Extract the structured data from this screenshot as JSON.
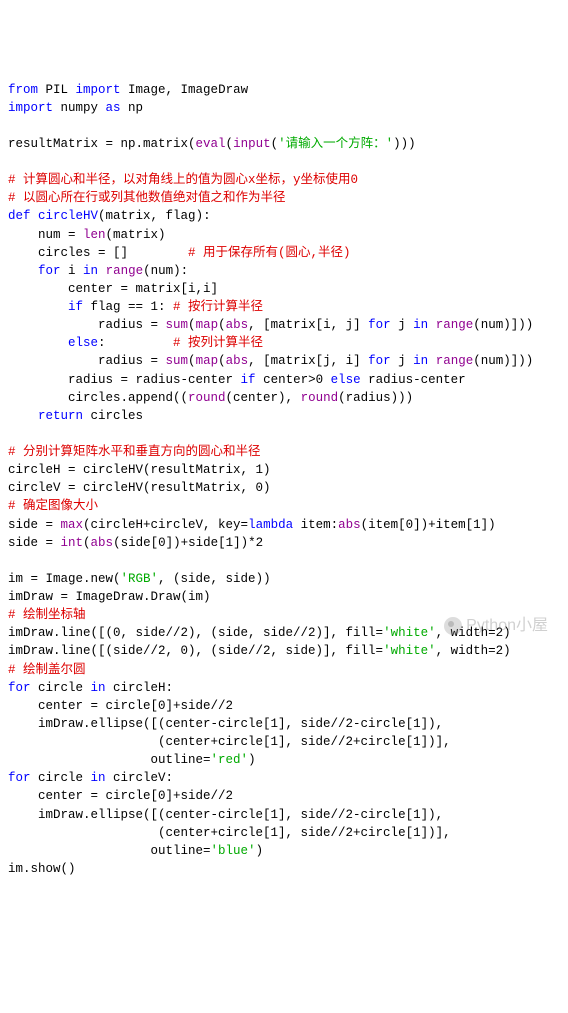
{
  "code": {
    "l01a": "from",
    "l01b": " PIL ",
    "l01c": "import",
    "l01d": " Image, ImageDraw",
    "l02a": "import",
    "l02b": " numpy ",
    "l02c": "as",
    "l02d": " np",
    "l03": "",
    "l04a": "resultMatrix = np.matrix(",
    "l04b": "eval",
    "l04c": "(",
    "l04d": "input",
    "l04e": "(",
    "l04f": "'请输入一个方阵：'",
    "l04g": ")))",
    "l05": "",
    "l06": "# 计算圆心和半径，以对角线上的值为圆心x坐标，y坐标使用0",
    "l07": "# 以圆心所在行或列其他数值绝对值之和作为半径",
    "l08a": "def",
    "l08b": " ",
    "l08c": "circleHV",
    "l08d": "(matrix, flag):",
    "l09a": "    num = ",
    "l09b": "len",
    "l09c": "(matrix)",
    "l10a": "    circles = []        ",
    "l10b": "# 用于保存所有(圆心,半径)",
    "l11a": "    ",
    "l11b": "for",
    "l11c": " i ",
    "l11d": "in",
    "l11e": " ",
    "l11f": "range",
    "l11g": "(num):",
    "l12": "        center = matrix[i,i]",
    "l13a": "        ",
    "l13b": "if",
    "l13c": " flag == 1: ",
    "l13d": "# 按行计算半径",
    "l14a": "            radius = ",
    "l14b": "sum",
    "l14c": "(",
    "l14d": "map",
    "l14e": "(",
    "l14f": "abs",
    "l14g": ", [matrix[i, j] ",
    "l14h": "for",
    "l14i": " j ",
    "l14j": "in",
    "l14k": " ",
    "l14l": "range",
    "l14m": "(num)]))",
    "l15a": "        ",
    "l15b": "else",
    "l15c": ":         ",
    "l15d": "# 按列计算半径",
    "l16a": "            radius = ",
    "l16b": "sum",
    "l16c": "(",
    "l16d": "map",
    "l16e": "(",
    "l16f": "abs",
    "l16g": ", [matrix[j, i] ",
    "l16h": "for",
    "l16i": " j ",
    "l16j": "in",
    "l16k": " ",
    "l16l": "range",
    "l16m": "(num)]))",
    "l17a": "        radius = radius-center ",
    "l17b": "if",
    "l17c": " center>0 ",
    "l17d": "else",
    "l17e": " radius-center",
    "l18a": "        circles.append((",
    "l18b": "round",
    "l18c": "(center), ",
    "l18d": "round",
    "l18e": "(radius)))",
    "l19a": "    ",
    "l19b": "return",
    "l19c": " circles",
    "l20": "",
    "l21": "# 分别计算矩阵水平和垂直方向的圆心和半径",
    "l22": "circleH = circleHV(resultMatrix, 1)",
    "l23": "circleV = circleHV(resultMatrix, 0)",
    "l24": "# 确定图像大小",
    "l25a": "side = ",
    "l25b": "max",
    "l25c": "(circleH+circleV, key=",
    "l25d": "lambda",
    "l25e": " item:",
    "l25f": "abs",
    "l25g": "(item[0])+item[1])",
    "l26a": "side = ",
    "l26b": "int",
    "l26c": "(",
    "l26d": "abs",
    "l26e": "(side[0])+side[1])*2",
    "l27": "",
    "l28a": "im = Image.new(",
    "l28b": "'RGB'",
    "l28c": ", (side, side))",
    "l29": "imDraw = ImageDraw.Draw(im)",
    "l30": "# 绘制坐标轴",
    "l31a": "imDraw.line([(0, side//2), (side, side//2)], fill=",
    "l31b": "'white'",
    "l31c": ", width=2)",
    "l32a": "imDraw.line([(side//2, 0), (side//2, side)], fill=",
    "l32b": "'white'",
    "l32c": ", width=2)",
    "l33": "# 绘制盖尔圆",
    "l34a": "for",
    "l34b": " circle ",
    "l34c": "in",
    "l34d": " circleH:",
    "l35": "    center = circle[0]+side//2",
    "l36": "    imDraw.ellipse([(center-circle[1], side//2-circle[1]),",
    "l37": "                    (center+circle[1], side//2+circle[1])],",
    "l38a": "                   outline=",
    "l38b": "'red'",
    "l38c": ")",
    "l39a": "for",
    "l39b": " circle ",
    "l39c": "in",
    "l39d": " circleV:",
    "l40": "    center = circle[0]+side//2",
    "l41": "    imDraw.ellipse([(center-circle[1], side//2-circle[1]),",
    "l42": "                    (center+circle[1], side//2+circle[1])],",
    "l43a": "                   outline=",
    "l43b": "'blue'",
    "l43c": ")",
    "l44": "im.show()"
  },
  "watermark": "Python小屋"
}
